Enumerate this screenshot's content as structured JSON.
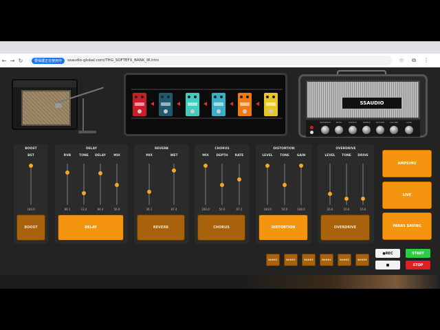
{
  "browser": {
    "chip_label": "要保護正在使用中",
    "url": "ssaudio-global.com/THG_SOFTEFX_BANK_IR.htm",
    "nav_back": "←",
    "nav_forward": "→",
    "nav_reload": "↻",
    "star_icon": "☆",
    "extensions_icon": "⧉",
    "menu_icon": "⋮"
  },
  "amp_head": {
    "logo": "SSAUDIO",
    "knob_labels": [
      "PRESENCE",
      "BASS",
      "MIDDLE",
      "TREBLE",
      "MASTER",
      "VOLUME",
      "GAIN"
    ]
  },
  "modules": [
    {
      "title": "BOOST",
      "sliders": [
        {
          "label": "BST",
          "value": "100.0",
          "level": 1.0
        }
      ],
      "button": "BOOST",
      "active": false
    },
    {
      "title": "DELAY",
      "sliders": [
        {
          "label": "RVB",
          "value": "86.1",
          "level": 0.82
        },
        {
          "label": "TONE",
          "value": "33.4",
          "level": 0.28
        },
        {
          "label": "DELAY",
          "value": "84.4",
          "level": 0.8
        },
        {
          "label": "MIX",
          "value": "56.0",
          "level": 0.5
        }
      ],
      "button": "DELAY",
      "active": true
    },
    {
      "title": "REVERB",
      "sliders": [
        {
          "label": "MIX",
          "value": "36.1",
          "level": 0.32
        },
        {
          "label": "WET",
          "value": "87.4",
          "level": 0.88
        }
      ],
      "button": "REVERB",
      "active": false
    },
    {
      "title": "CHORUS",
      "sliders": [
        {
          "label": "MIX",
          "value": "100.0",
          "level": 1.0
        },
        {
          "label": "DEPTH",
          "value": "50.0",
          "level": 0.5
        },
        {
          "label": "RATE",
          "value": "67.2",
          "level": 0.65
        }
      ],
      "button": "CHORUS",
      "active": false
    },
    {
      "title": "DISTORTION",
      "sliders": [
        {
          "label": "LEVEL",
          "value": "100.0",
          "level": 1.0
        },
        {
          "label": "TONE",
          "value": "50.0",
          "level": 0.5
        },
        {
          "label": "GAIN",
          "value": "100.0",
          "level": 1.0
        }
      ],
      "button": "DISTORTION",
      "active": true
    },
    {
      "title": "OVERDRIVE",
      "sliders": [
        {
          "label": "LEVEL",
          "value": "26.6",
          "level": 0.26
        },
        {
          "label": "TONE",
          "value": "16.6",
          "level": 0.14
        },
        {
          "label": "DRIVE",
          "value": "16.6",
          "level": 0.14
        }
      ],
      "button": "OVERDRIVE",
      "active": false
    }
  ],
  "side_buttons": [
    "AMPSIMU",
    "LIVE",
    "PARAS SAVING"
  ],
  "banks": [
    "BANK1",
    "BANK2",
    "BANK3",
    "BANK4",
    "BANK5",
    "BANK6"
  ],
  "controls": {
    "rec": "●REC",
    "stop": "■",
    "start": "START",
    "stop_red": "STOP"
  },
  "colors": {
    "accent": "#f5940f",
    "inactive": "#a8620c",
    "start": "#2ecc40",
    "stop": "#e02020"
  }
}
